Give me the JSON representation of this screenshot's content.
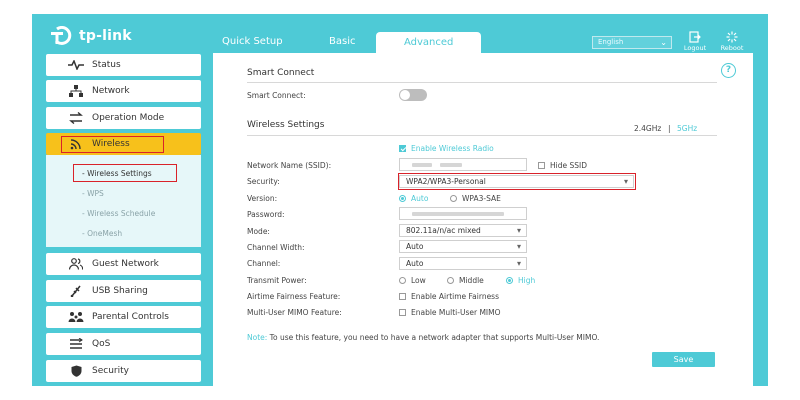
{
  "header": {
    "brand": "tp-link",
    "tabs": [
      {
        "label": "Quick Setup"
      },
      {
        "label": "Basic"
      },
      {
        "label": "Advanced"
      }
    ],
    "language": "English",
    "logout_label": "Logout",
    "reboot_label": "Reboot"
  },
  "sidebar": {
    "items": [
      {
        "label": "Status",
        "icon": "pulse-icon"
      },
      {
        "label": "Network",
        "icon": "network-icon"
      },
      {
        "label": "Operation Mode",
        "icon": "operation-mode-icon"
      },
      {
        "label": "Wireless",
        "icon": "wifi-icon"
      },
      {
        "label": "Guest Network",
        "icon": "guest-icon"
      },
      {
        "label": "USB Sharing",
        "icon": "usb-icon"
      },
      {
        "label": "Parental Controls",
        "icon": "parental-icon"
      },
      {
        "label": "QoS",
        "icon": "qos-icon"
      },
      {
        "label": "Security",
        "icon": "shield-icon"
      }
    ],
    "wireless_sub": [
      {
        "label": "- Wireless Settings"
      },
      {
        "label": "- WPS"
      },
      {
        "label": "- Wireless Schedule"
      },
      {
        "label": "- OneMesh"
      }
    ]
  },
  "main": {
    "smart_connect_title": "Smart Connect",
    "smart_connect_label": "Smart Connect:",
    "smart_connect_on": false,
    "wireless_title": "Wireless Settings",
    "band_24": "2.4GHz",
    "band_sep": "|",
    "band_5": "5GHz",
    "enable_radio": "Enable Wireless Radio",
    "ssid_label": "Network Name (SSID):",
    "hide_ssid": "Hide SSID",
    "security_label": "Security:",
    "security_value": "WPA2/WPA3-Personal",
    "version_label": "Version:",
    "version_auto": "Auto",
    "version_sae": "WPA3-SAE",
    "password_label": "Password:",
    "mode_label": "Mode:",
    "mode_value": "802.11a/n/ac mixed",
    "channel_width_label": "Channel Width:",
    "channel_width_value": "Auto",
    "channel_label": "Channel:",
    "channel_value": "Auto",
    "tx_power_label": "Transmit Power:",
    "tx_low": "Low",
    "tx_middle": "Middle",
    "tx_high": "High",
    "airtime_label": "Airtime Fairness Feature:",
    "airtime_option": "Enable Airtime Fairness",
    "mumimo_label": "Multi-User MIMO Feature:",
    "mumimo_option": "Enable Multi-User MIMO",
    "note_prefix": "Note:",
    "note_text": "To use this feature, you need to have a network adapter that supports Multi-User MIMO.",
    "save_label": "Save"
  },
  "colors": {
    "accent": "#4ecad6",
    "active_nav": "#f7c11b",
    "highlight_box": "#d9222a"
  }
}
